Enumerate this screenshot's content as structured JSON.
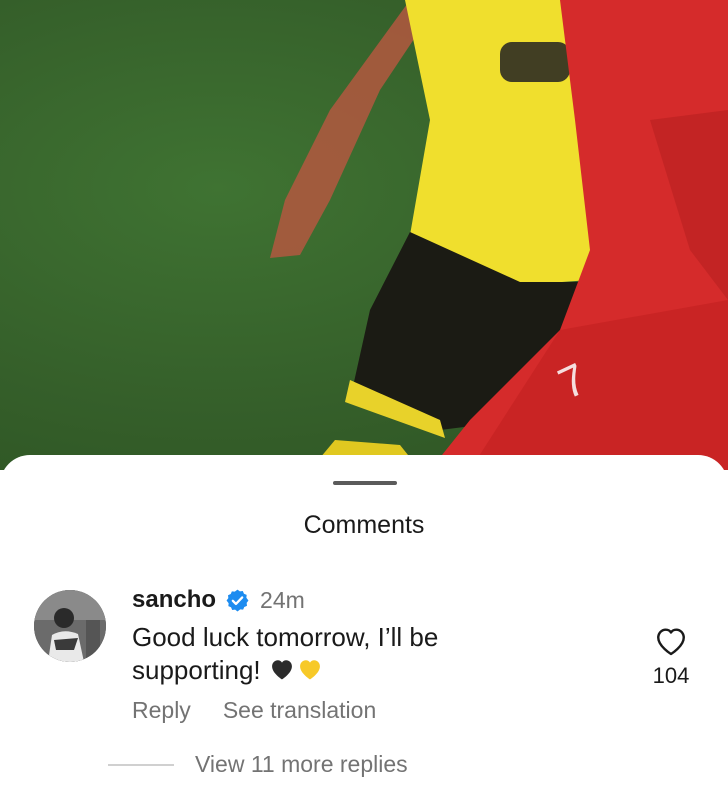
{
  "video": {
    "pitch_color": "#3b6a2f",
    "player_left_kit": "#f2e22e",
    "player_right_kit": "#d42a2a",
    "shirt_number_right": "7"
  },
  "sheet": {
    "title": "Comments"
  },
  "comment": {
    "username": "sancho",
    "verified_icon": "verified-badge-icon",
    "verified_color": "#1d8cf0",
    "timestamp": "24m",
    "text": "Good luck tomorrow, I’ll be supporting! ",
    "emojis": [
      "black-heart-icon",
      "yellow-heart-icon"
    ],
    "actions": {
      "reply": "Reply",
      "see_translation": "See translation"
    },
    "likes": "104"
  },
  "replies": {
    "label": "View 11 more replies"
  }
}
